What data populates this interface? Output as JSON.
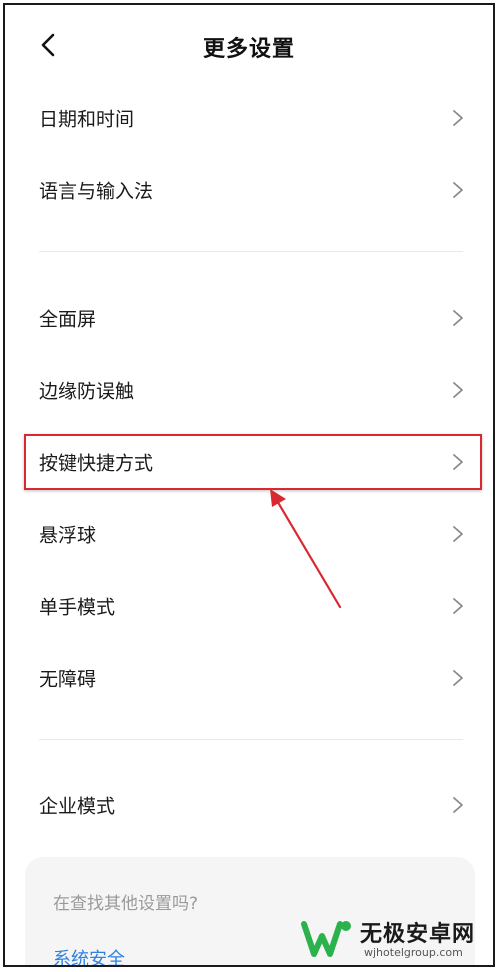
{
  "header": {
    "title": "更多设置",
    "back_icon": "chevron-left-icon"
  },
  "settings_groups": [
    {
      "items": [
        {
          "label": "日期和时间"
        },
        {
          "label": "语言与输入法"
        }
      ]
    },
    {
      "items": [
        {
          "label": "全面屏"
        },
        {
          "label": "边缘防误触"
        },
        {
          "label": "按键快捷方式",
          "highlighted": true
        },
        {
          "label": "悬浮球"
        },
        {
          "label": "单手模式"
        },
        {
          "label": "无障碍"
        }
      ]
    },
    {
      "items": [
        {
          "label": "企业模式"
        }
      ]
    }
  ],
  "search_card": {
    "title": "在查找其他设置吗?",
    "link": "系统安全"
  },
  "watermark": {
    "name": "无极安卓网",
    "url": "wjhotelgroup.com"
  },
  "colors": {
    "highlight": "#d9282f",
    "link": "#2f7fe0",
    "watermark_green": "#2bb24c"
  },
  "icons": {
    "item_chevron": "chevron-right-icon",
    "annotation": "red-arrow-icon"
  }
}
